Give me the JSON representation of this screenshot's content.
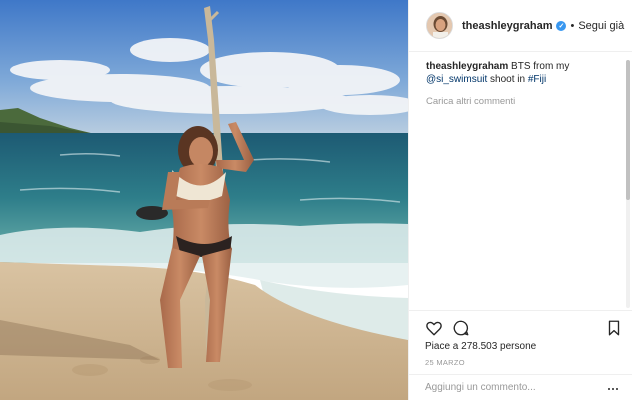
{
  "post": {
    "username": "theashleygraham",
    "follow_label": "Segui già",
    "separator": "•"
  },
  "caption": {
    "user": "theashleygraham",
    "text_before": " BTS from my ",
    "mention": "@si_swimsuit",
    "text_middle": " shoot in ",
    "hashtag": "#Fiji"
  },
  "comments": {
    "load_more": "Carica altri commenti"
  },
  "stats": {
    "likes": "Piace a 278.503 persone",
    "date": "25 MARZO"
  },
  "add_comment": {
    "placeholder": "Aggiungi un commento..."
  },
  "icons": {
    "like": "heart-icon",
    "comment": "comment-icon",
    "save": "bookmark-icon",
    "verified": "verified-badge-icon",
    "more": "more-options-icon"
  },
  "colors": {
    "link": "#003569",
    "verified": "#3897f0",
    "muted": "#999999",
    "text": "#262626"
  }
}
